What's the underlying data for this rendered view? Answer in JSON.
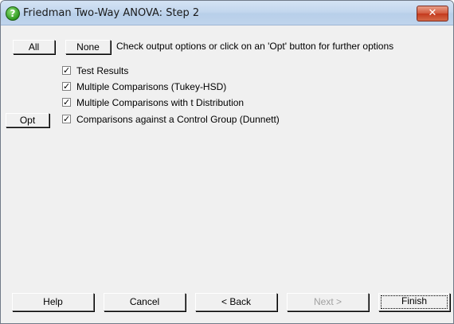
{
  "window": {
    "title": "Friedman Two-Way ANOVA: Step 2",
    "close_glyph": "✕"
  },
  "toolbar": {
    "all_label": "All",
    "none_label": "None",
    "help_text": "Check output options or click on an 'Opt' button for further options"
  },
  "options": [
    {
      "label": "Test Results",
      "checked": true
    },
    {
      "label": "Multiple Comparisons (Tukey-HSD)",
      "checked": true
    },
    {
      "label": "Multiple Comparisons with t Distribution",
      "checked": true
    },
    {
      "label": "Comparisons against a Control Group (Dunnett)",
      "checked": true
    }
  ],
  "opt_button_label": "Opt",
  "footer": {
    "help_label": "Help",
    "cancel_label": "Cancel",
    "back_label": "< Back",
    "next_label": "Next >",
    "finish_label": "Finish"
  },
  "colors": {
    "close_button": "#c4391d",
    "title_bar": "#c3d7ee"
  },
  "icons": {
    "title_icon": "help-question-icon"
  }
}
